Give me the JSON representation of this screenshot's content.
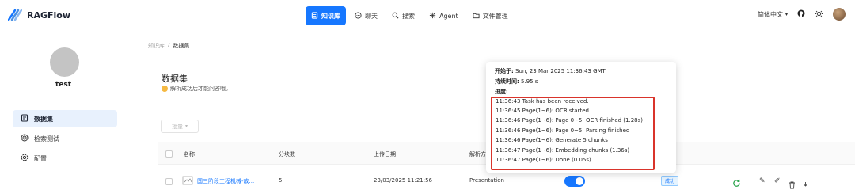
{
  "app": {
    "name": "RAGFlow"
  },
  "nav": [
    {
      "label": "知识库",
      "icon": "database-icon",
      "active": true
    },
    {
      "label": "聊天",
      "icon": "chat-icon",
      "active": false
    },
    {
      "label": "搜索",
      "icon": "search-icon",
      "active": false
    },
    {
      "label": "Agent",
      "icon": "agent-icon",
      "active": false
    },
    {
      "label": "文件管理",
      "icon": "folder-icon",
      "active": false
    }
  ],
  "header_right": {
    "language": "简体中文"
  },
  "sidebar": {
    "username": "test",
    "items": [
      {
        "label": "数据集",
        "icon": "dataset-icon",
        "active": true
      },
      {
        "label": "检索测试",
        "icon": "retrieval-icon",
        "active": false
      },
      {
        "label": "配置",
        "icon": "settings-icon",
        "active": false
      }
    ]
  },
  "breadcrumb": {
    "parent": "知识库",
    "sep": "/",
    "current": "数据集"
  },
  "dataset": {
    "title": "数据集",
    "description": "解析成功后才能问答哦。",
    "batch_label": "批量"
  },
  "table": {
    "headers": [
      "名称",
      "分块数",
      "上传日期",
      "解析方法"
    ],
    "rows": [
      {
        "name": "国三阶段工程机械-故...",
        "chunks": "5",
        "date": "23/03/2025 11:21:56",
        "method": "Presentation",
        "status": "成功"
      }
    ]
  },
  "popup": {
    "start_label": "开始于:",
    "start_value": "Sun, 23 Mar 2025 11:36:43 GMT",
    "duration_label": "持续时间:",
    "duration_value": "5.95 s",
    "progress_label": "进度:",
    "logs": [
      "11:36:43 Task has been received.",
      "11:36:45 Page(1~6): OCR started",
      "11:36:46 Page(1~6): Page 0~5: OCR finished (1.28s)",
      "11:36:46 Page(1~6): Page 0~5: Parsing finished",
      "11:36:46 Page(1~6): Generate 5 chunks",
      "11:36:47 Page(1~6): Embedding chunks (1.36s)",
      "11:36:47 Page(1~6): Done (0.05s)"
    ]
  },
  "colors": {
    "accent": "#1677ff",
    "highlight": "#d9342b"
  }
}
